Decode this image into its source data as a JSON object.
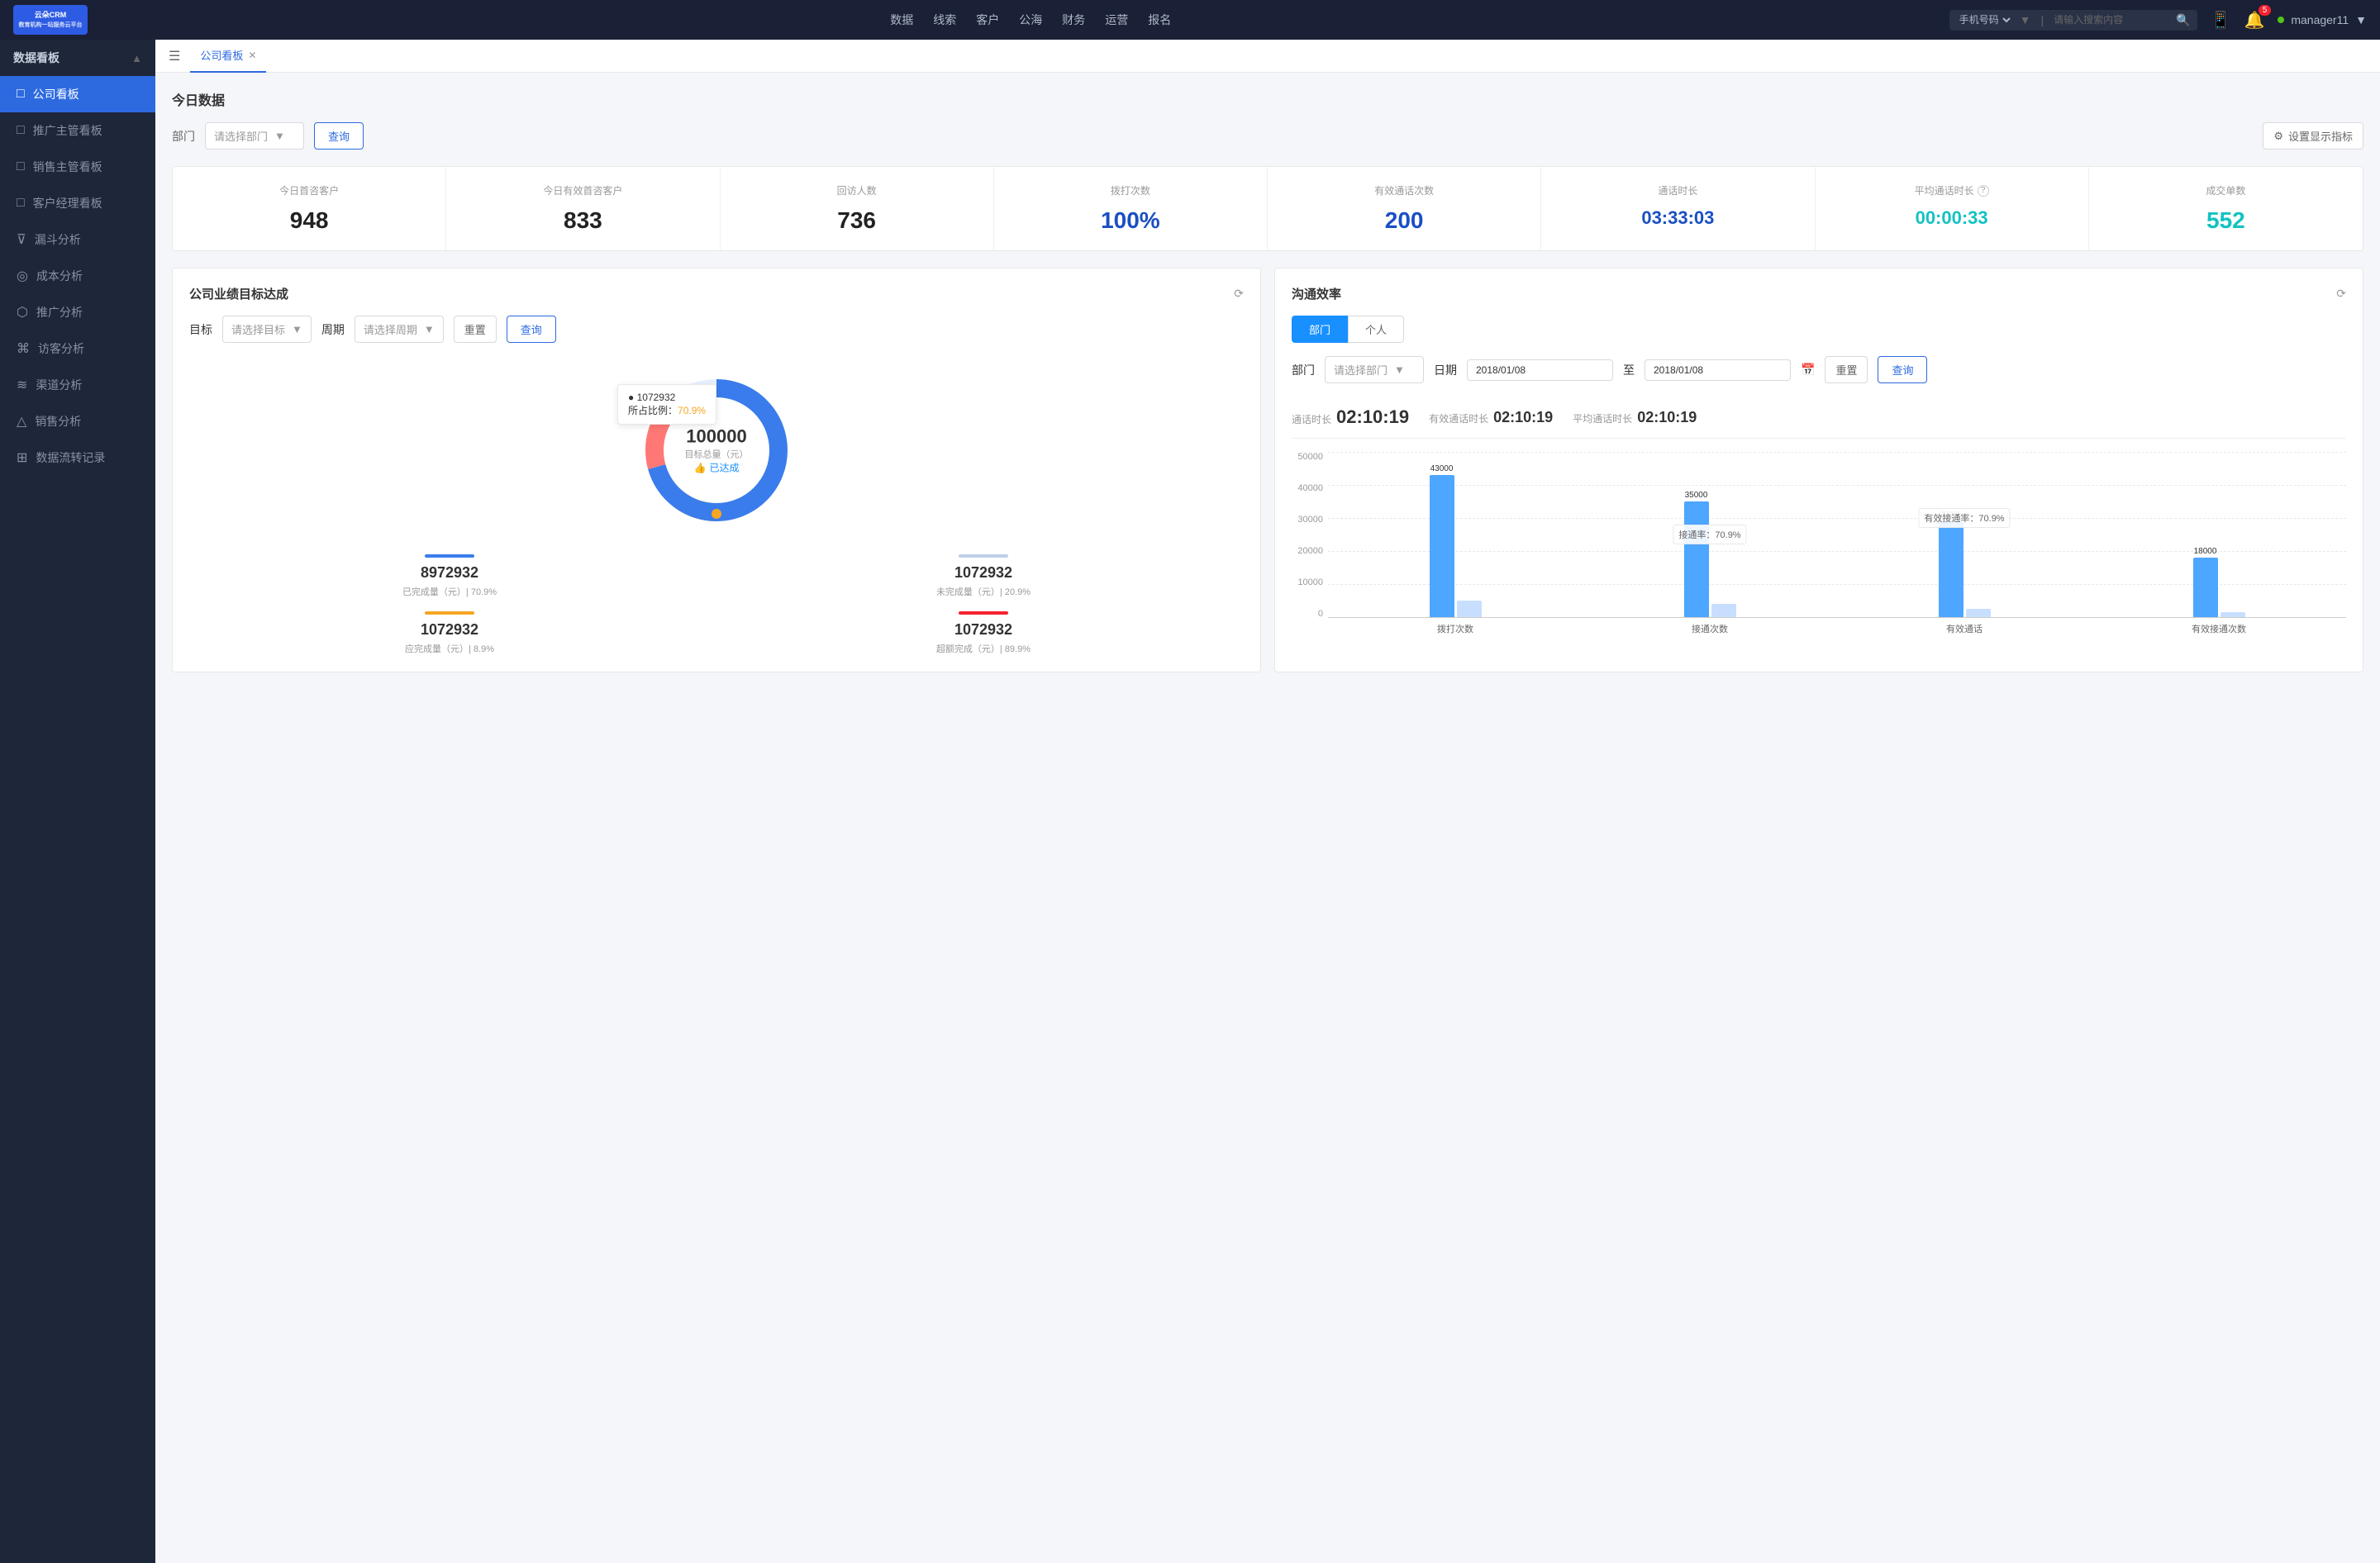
{
  "topNav": {
    "logo": "云朵CRM",
    "logoSub": "教育机构一站服务云平台",
    "navItems": [
      "数据",
      "线索",
      "客户",
      "公海",
      "财务",
      "运营",
      "报名"
    ],
    "searchPlaceholder": "请输入搜索内容",
    "searchSelect": "手机号码",
    "userStatus": "online",
    "username": "manager11",
    "notificationCount": "5"
  },
  "sidebar": {
    "sectionTitle": "数据看板",
    "items": [
      {
        "label": "公司看板",
        "active": true,
        "icon": "📊"
      },
      {
        "label": "推广主管看板",
        "active": false,
        "icon": "📋"
      },
      {
        "label": "销售主管看板",
        "active": false,
        "icon": "📈"
      },
      {
        "label": "客户经理看板",
        "active": false,
        "icon": "👤"
      },
      {
        "label": "漏斗分析",
        "active": false,
        "icon": "⊽"
      },
      {
        "label": "成本分析",
        "active": false,
        "icon": "○"
      },
      {
        "label": "推广分析",
        "active": false,
        "icon": "⬡"
      },
      {
        "label": "访客分析",
        "active": false,
        "icon": "⌘"
      },
      {
        "label": "渠道分析",
        "active": false,
        "icon": "≋"
      },
      {
        "label": "销售分析",
        "active": false,
        "icon": "△"
      },
      {
        "label": "数据流转记录",
        "active": false,
        "icon": "⊞"
      }
    ]
  },
  "tabs": {
    "items": [
      {
        "label": "公司看板",
        "active": true,
        "closable": true
      }
    ]
  },
  "todayData": {
    "title": "今日数据",
    "filterLabel": "部门",
    "filterPlaceholder": "请选择部门",
    "queryBtn": "查询",
    "settingsBtn": "设置显示指标",
    "stats": [
      {
        "label": "今日首咨客户",
        "value": "948",
        "color": "black"
      },
      {
        "label": "今日有效首咨客户",
        "value": "833",
        "color": "black"
      },
      {
        "label": "回访人数",
        "value": "736",
        "color": "black"
      },
      {
        "label": "拨打次数",
        "value": "100%",
        "color": "dark-blue"
      },
      {
        "label": "有效通话次数",
        "value": "200",
        "color": "dark-blue"
      },
      {
        "label": "通话时长",
        "value": "03:33:03",
        "color": "dark-blue"
      },
      {
        "label": "平均通话时长",
        "value": "00:00:33",
        "color": "cyan"
      },
      {
        "label": "成交单数",
        "value": "552",
        "color": "cyan"
      }
    ]
  },
  "goalCard": {
    "title": "公司业绩目标达成",
    "targetLabel": "目标",
    "targetPlaceholder": "请选择目标",
    "periodLabel": "周期",
    "periodPlaceholder": "请选择周期",
    "resetBtn": "重置",
    "queryBtn": "查询",
    "donut": {
      "centerValue": "100000",
      "centerLabel": "目标总量（元）",
      "badge": "已达成",
      "tooltip": {
        "value": "1072932",
        "label": "所占比例：",
        "percent": "70.9%"
      }
    },
    "stats": [
      {
        "label": "已完成量（元）| 70.9%",
        "value": "8972932",
        "color": "#1890ff"
      },
      {
        "label": "未完成量（元）| 20.9%",
        "value": "1072932",
        "color": "#c0cfe8"
      },
      {
        "label": "应完成量（元）| 8.9%",
        "value": "1072932",
        "color": "#f5a623"
      },
      {
        "label": "超额完成（元）| 89.9%",
        "value": "1072932",
        "color": "#f5222d"
      }
    ]
  },
  "commCard": {
    "title": "沟通效率",
    "tabDept": "部门",
    "tabPerson": "个人",
    "deptLabel": "部门",
    "deptPlaceholder": "请选择部门",
    "dateLabel": "日期",
    "dateFrom": "2018/01/08",
    "dateTo": "2018/01/08",
    "resetBtn": "重置",
    "queryBtn": "查询",
    "stats": {
      "callDuration": {
        "label": "通话时长",
        "value": "02:10:19"
      },
      "effectiveDuration": {
        "label": "有效通话时长",
        "value": "02:10:19"
      },
      "avgDuration": {
        "label": "平均通话时长",
        "value": "02:10:19"
      }
    },
    "chart": {
      "yLabels": [
        "50000",
        "40000",
        "30000",
        "20000",
        "10000",
        "0"
      ],
      "groups": [
        {
          "xLabel": "拨打次数",
          "bars": [
            {
              "value": 43000,
              "label": "43000",
              "heightPct": 86,
              "light": false
            },
            {
              "value": 0,
              "label": "",
              "heightPct": 10,
              "light": true
            }
          ]
        },
        {
          "xLabel": "接通次数",
          "bars": [
            {
              "value": 35000,
              "label": "35000",
              "heightPct": 70,
              "light": false
            },
            {
              "value": 0,
              "label": "",
              "heightPct": 8,
              "light": true
            }
          ],
          "annotation": "接通率：70.9%"
        },
        {
          "xLabel": "有效通话",
          "bars": [
            {
              "value": 29000,
              "label": "29000",
              "heightPct": 58,
              "light": false
            },
            {
              "value": 0,
              "label": "",
              "heightPct": 5,
              "light": true
            }
          ],
          "annotation": "有效接通率：70.9%"
        },
        {
          "xLabel": "有效接通次数",
          "bars": [
            {
              "value": 18000,
              "label": "18000",
              "heightPct": 36,
              "light": false
            },
            {
              "value": 0,
              "label": "",
              "heightPct": 3,
              "light": true
            }
          ]
        }
      ]
    }
  }
}
